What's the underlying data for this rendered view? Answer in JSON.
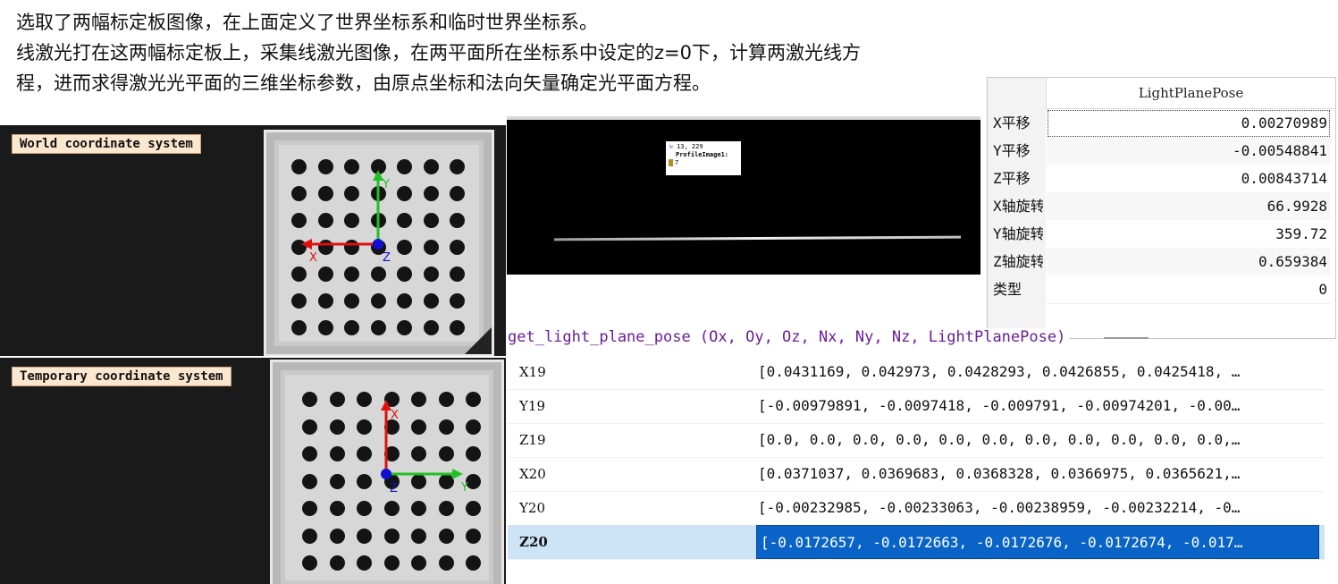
{
  "intro": {
    "line1": "选取了两幅标定板图像，在上面定义了世界坐标系和临时世界坐标系。",
    "line2": "线激光打在这两幅标定板上，采集线激光图像，在两平面所在坐标系中设定的z=0下，计算两激光线方",
    "line3": "程，进而求得激光光平面的三维坐标参数，由原点坐标和法向矢量确定光平面方程。"
  },
  "calib_world": {
    "label": "World coordinate system",
    "axis_x": "X",
    "axis_y": "Y",
    "axis_z": "Z"
  },
  "calib_temp": {
    "label": "Temporary coordinate system",
    "axis_x": "X",
    "axis_y": "Y",
    "axis_z": "Z"
  },
  "laser": {
    "tooltip_coords": "13, 229",
    "tooltip_name": "ProfileImage1:",
    "tooltip_value": "7"
  },
  "param_table": {
    "header": "LightPlanePose",
    "rows": [
      {
        "name": "X平移",
        "value": "0.00270989"
      },
      {
        "name": "Y平移",
        "value": "-0.00548841"
      },
      {
        "name": "Z平移",
        "value": "0.00843714"
      },
      {
        "name": "X轴旋转",
        "value": "66.9928"
      },
      {
        "name": "Y轴旋转",
        "value": "359.72"
      },
      {
        "name": "Z轴旋转",
        "value": "0.659384"
      },
      {
        "name": "类型",
        "value": "0"
      }
    ]
  },
  "operator": {
    "signature": "get_light_plane_pose (Ox, Oy, Oz, Nx, Ny, Nz, LightPlanePose)"
  },
  "var_table": {
    "rows": [
      {
        "name": "X19",
        "value": "[0.0431169, 0.042973, 0.0428293, 0.0426855, 0.0425418, …"
      },
      {
        "name": "Y19",
        "value": "[-0.00979891, -0.0097418, -0.009791, -0.00974201, -0.00…"
      },
      {
        "name": "Z19",
        "value": "[0.0, 0.0, 0.0, 0.0, 0.0, 0.0, 0.0, 0.0, 0.0, 0.0, 0.0,…"
      },
      {
        "name": "X20",
        "value": "[0.0371037, 0.0369683, 0.0368328, 0.0366975, 0.0365621,…"
      },
      {
        "name": "Y20",
        "value": "[-0.00232985, -0.00233063, -0.00238959, -0.00232214, -0…"
      },
      {
        "name": "Z20",
        "value": "[-0.0172657, -0.0172663, -0.0172676, -0.0172674, -0.017…"
      }
    ],
    "selected_index": 5
  },
  "colors": {
    "axis_red": "#e01010",
    "axis_green": "#22c022",
    "axis_blue": "#1010d0",
    "selection_blue": "#0a64c8",
    "operator_purple": "#6a1d9a"
  }
}
